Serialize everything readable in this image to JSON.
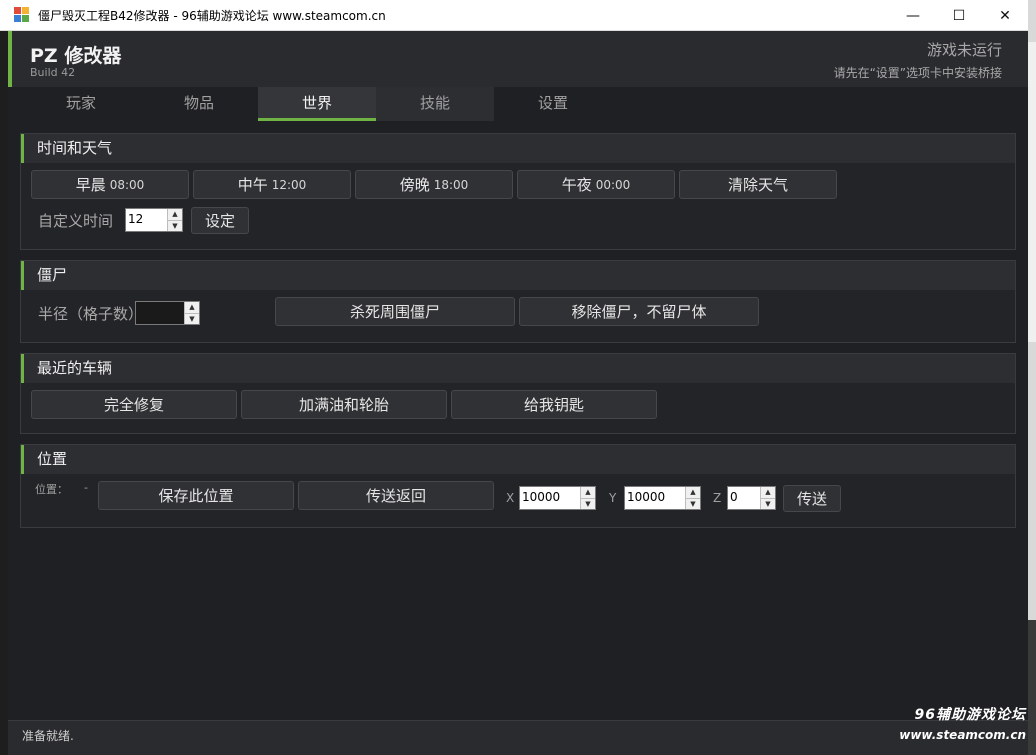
{
  "window": {
    "title": "僵尸毁灭工程B42修改器 - 96辅助游戏论坛 www.steamcom.cn",
    "controls": [
      "—",
      "☐",
      "✕"
    ]
  },
  "header": {
    "title": "PZ 修改器",
    "subtitle": "Build 42",
    "status": "游戏未运行",
    "status_hint": "请先在“设置”选项卡中安装桥接",
    "accent_color": "#6fb444"
  },
  "tabs": [
    {
      "label": "玩家"
    },
    {
      "label": "物品"
    },
    {
      "label": "世界",
      "active": true
    },
    {
      "label": "技能"
    },
    {
      "label": "设置"
    }
  ],
  "time_weather": {
    "title": "时间和天气",
    "buttons": [
      {
        "label": "早晨",
        "time": "08:00"
      },
      {
        "label": "中午",
        "time": "12:00"
      },
      {
        "label": "傍晚",
        "time": "18:00"
      },
      {
        "label": "午夜",
        "time": "00:00"
      },
      {
        "label": "清除天气",
        "time": ""
      }
    ],
    "custom_label": "自定义时间",
    "custom_value": "12",
    "set_button": "设定"
  },
  "zombies": {
    "title": "僵尸",
    "radius_label": "半径（格子数）",
    "radius_value": "",
    "kill_button": "杀死周围僵尸",
    "remove_button": "移除僵尸，不留尸体"
  },
  "vehicles": {
    "title": "最近的车辆",
    "buttons": [
      "完全修复",
      "加满油和轮胎",
      "给我钥匙"
    ]
  },
  "position": {
    "title": "位置",
    "label": "位置：",
    "value": "-",
    "save_button": "保存此位置",
    "return_button": "传送返回",
    "x_label": "X",
    "x_value": "10000",
    "y_label": "Y",
    "y_value": "10000",
    "z_label": "Z",
    "z_value": "0",
    "teleport_button": "传送"
  },
  "statusbar": {
    "text": "准备就绪."
  },
  "watermark": {
    "line1": "96辅助游戏论坛",
    "line2": "www.steamcom.cn"
  }
}
